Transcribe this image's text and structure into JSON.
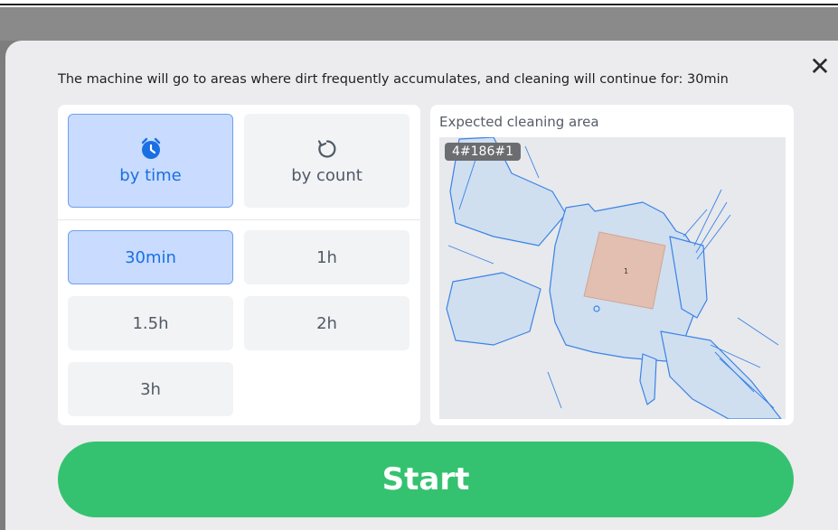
{
  "description": "The machine will go to areas where dirt frequently accumulates, and cleaning will continue for: 30min",
  "close_symbol": "✕",
  "modes": [
    {
      "label": "by time",
      "icon": "alarm-clock-icon",
      "active": true
    },
    {
      "label": "by count",
      "icon": "refresh-icon",
      "active": false
    }
  ],
  "durations": [
    {
      "label": "30min",
      "active": true
    },
    {
      "label": "1h",
      "active": false
    },
    {
      "label": "1.5h",
      "active": false
    },
    {
      "label": "2h",
      "active": false
    },
    {
      "label": "3h",
      "active": false
    }
  ],
  "area": {
    "title": "Expected cleaning area",
    "map_name": "4#186#1",
    "zone_label": "1"
  },
  "start_label": "Start",
  "colors": {
    "accent_blue": "#1a6fe3",
    "selected_bg": "#c9dcff",
    "start_green": "#35c270",
    "map_line": "#3b82e6",
    "zone_fill": "#e2bfb0"
  }
}
